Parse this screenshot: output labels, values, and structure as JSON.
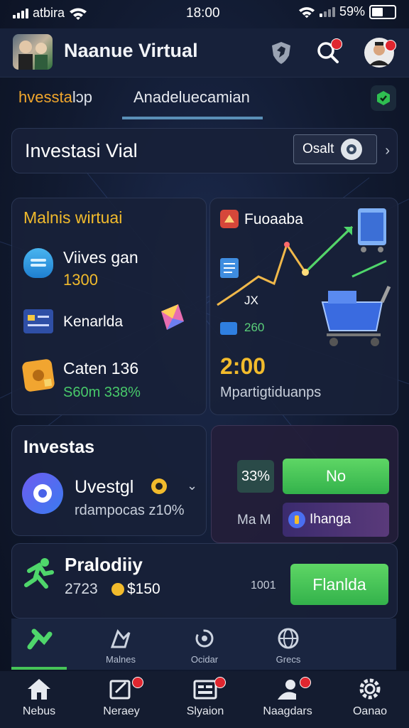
{
  "status_bar": {
    "carrier": "atbira",
    "time": "18:00",
    "battery": "59%",
    "battery_level": 0.59
  },
  "header": {
    "title": "Naanue Virtual",
    "icons": [
      "shield-icon",
      "search-icon",
      "profile-avatar"
    ]
  },
  "tabs": [
    {
      "label": "hvessta",
      "label_suffix": "lɔp",
      "active": false
    },
    {
      "label": "Anadeluecamian",
      "active": true
    }
  ],
  "search_card": {
    "title": "Investasi  Vial",
    "button_label": "Osalt"
  },
  "left_panel": {
    "heading": "Malnis wirtuai",
    "items": [
      {
        "icon": "chat-bubble-icon",
        "title": "Viives gan",
        "value": "1300"
      },
      {
        "icon": "card-icon",
        "title": "Kenarlda"
      },
      {
        "icon": "wallet-icon",
        "title": "Caten 136",
        "subtitle": "S60m  338%"
      }
    ]
  },
  "right_panel": {
    "label": "Fuoaaba",
    "annotation_1": "JX",
    "annotation_2": "260",
    "big_value": "2:00",
    "caption": "Mpartigtiduanps"
  },
  "invest_card": {
    "title": "Investas",
    "name": "Uvestgl",
    "subtitle": "rdampocas z10%"
  },
  "stats_card": {
    "percent_label": "3%",
    "percent_prefix": "3",
    "no_button": "No",
    "left_label": "Ma M",
    "chip_label": "Ihanga"
  },
  "product_card": {
    "title": "Pralodiiy",
    "line": "2723",
    "amount": "$150",
    "side_text": "1001",
    "button": "Flanlda"
  },
  "sub_tabs": [
    {
      "icon": "run-icon",
      "label": "",
      "active": true
    },
    {
      "icon": "bird-icon",
      "label": "Malnes"
    },
    {
      "icon": "refresh-icon",
      "label": "Ocidar"
    },
    {
      "icon": "globe-icon",
      "label": "Grecs"
    }
  ],
  "bottom_nav": [
    {
      "icon": "home-icon",
      "label": "Nebus",
      "badge": false
    },
    {
      "icon": "edit-icon",
      "label": "Neraey",
      "badge": true
    },
    {
      "icon": "list-icon",
      "label": "Slyaion",
      "badge": true
    },
    {
      "icon": "person-icon",
      "label": "Naagdars",
      "badge": true
    },
    {
      "icon": "gear-icon",
      "label": "Oanao",
      "badge": false
    }
  ],
  "colors": {
    "accent_yellow": "#f2bb2c",
    "accent_green": "#46c458",
    "accent_blue": "#5a8fb7",
    "badge_red": "#e0262f"
  }
}
